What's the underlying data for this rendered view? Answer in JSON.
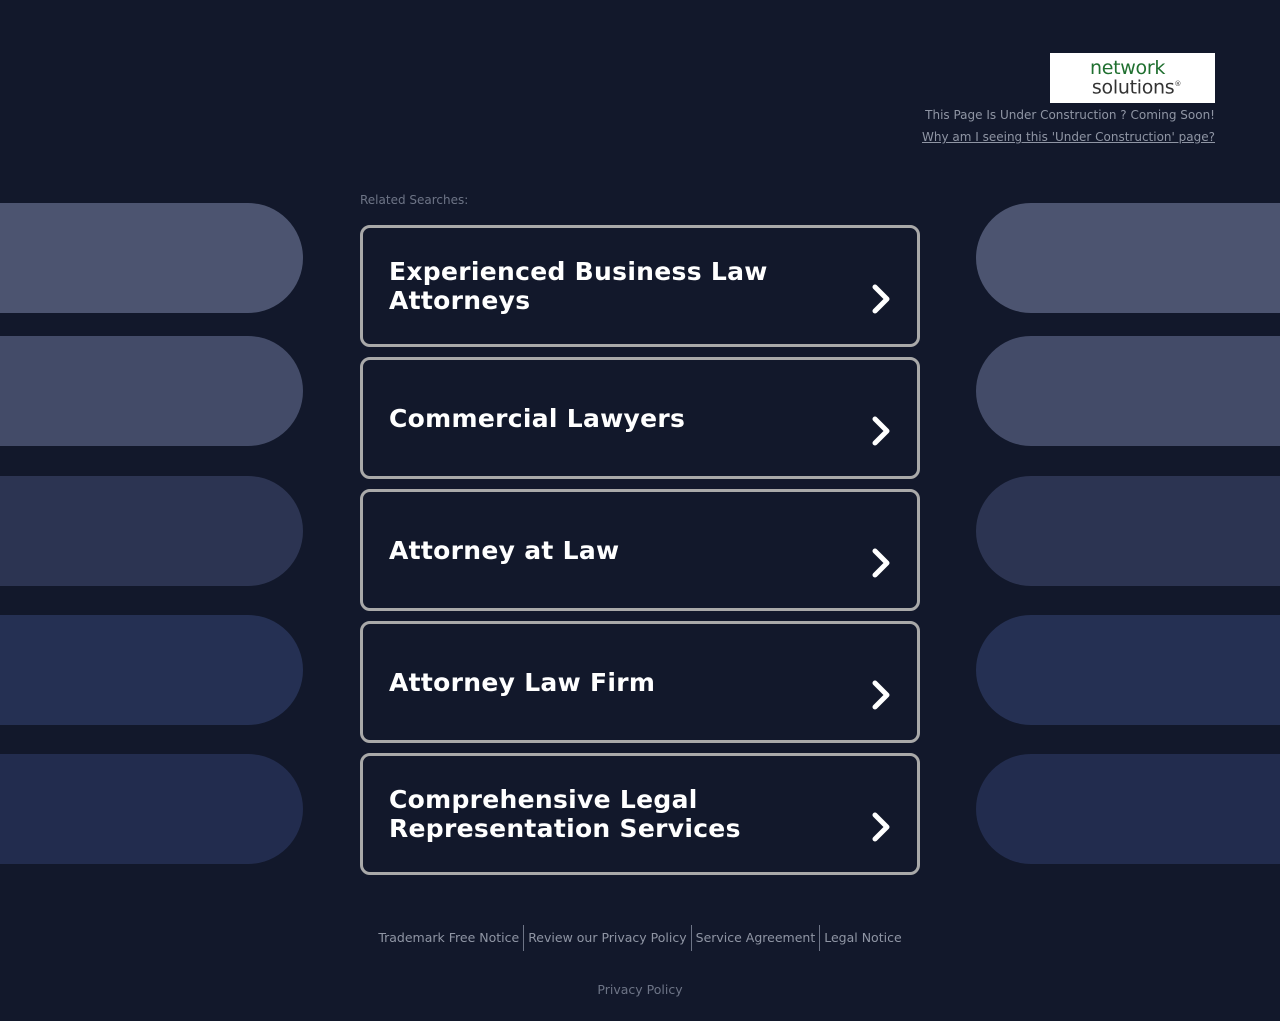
{
  "header": {
    "logo_line1": "network",
    "logo_line2": "solutions",
    "logo_mark": "®",
    "under_construction": "This Page Is Under Construction ? Coming Soon!",
    "why_link": "Why am I seeing this 'Under Construction' page?"
  },
  "related_label": "Related Searches:",
  "searches": [
    {
      "line1": "Experienced Business Law",
      "line2": "Attorneys"
    },
    {
      "line1": "Commercial Lawyers",
      "line2": ""
    },
    {
      "line1": "Attorney at Law",
      "line2": ""
    },
    {
      "line1": "Attorney Law Firm",
      "line2": ""
    },
    {
      "line1": "Comprehensive Legal",
      "line2": "Representation Services"
    }
  ],
  "footer": {
    "links": [
      "Trademark Free Notice",
      "Review our Privacy Policy",
      "Service Agreement",
      "Legal Notice"
    ],
    "privacy": "Privacy Policy"
  },
  "colors": {
    "background": "#12182b",
    "card_border": "#a9a9a9",
    "pill_colors": [
      "#4c5470",
      "#434b68",
      "#2c3452",
      "#253053",
      "#222c4e"
    ]
  },
  "icons": {
    "card_arrow": "chevron-right-icon"
  }
}
